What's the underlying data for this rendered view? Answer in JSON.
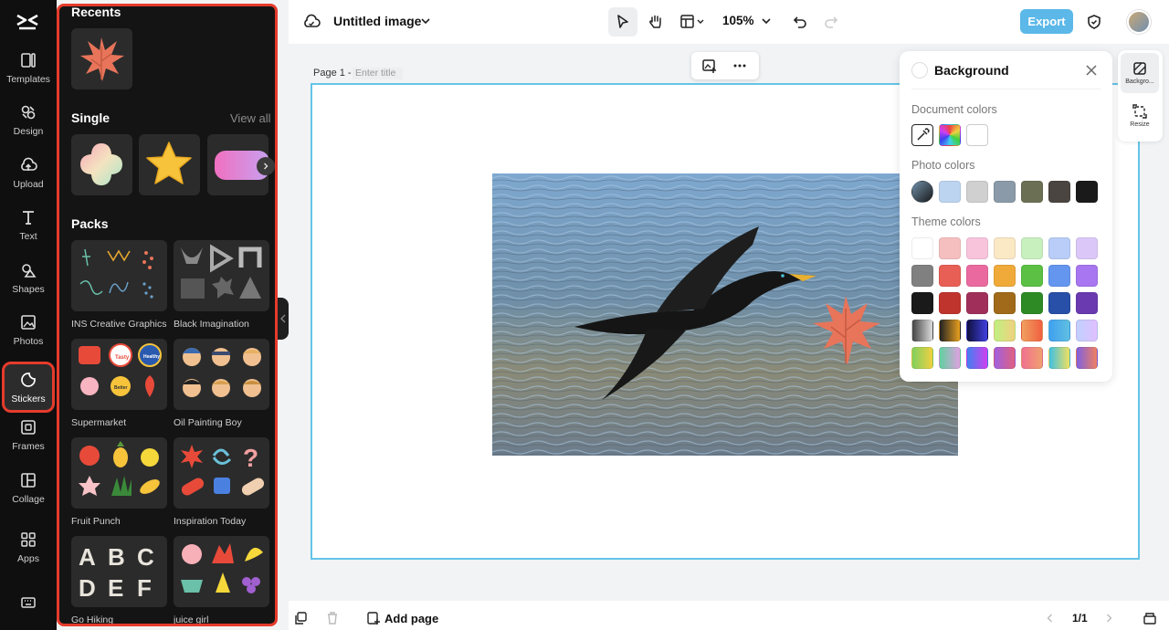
{
  "rail": {
    "items": [
      {
        "label": "Templates"
      },
      {
        "label": "Design"
      },
      {
        "label": "Upload"
      },
      {
        "label": "Text"
      },
      {
        "label": "Shapes"
      },
      {
        "label": "Photos"
      },
      {
        "label": "Stickers"
      },
      {
        "label": "Frames"
      },
      {
        "label": "Collage"
      },
      {
        "label": "Apps"
      }
    ],
    "active": "Stickers"
  },
  "panel": {
    "recents_title": "Recents",
    "single_title": "Single",
    "view_all": "View all",
    "packs_title": "Packs",
    "packs": [
      {
        "name": "INS Creative Graphics"
      },
      {
        "name": "Black Imagination"
      },
      {
        "name": "Supermarket"
      },
      {
        "name": "Oil Painting Boy"
      },
      {
        "name": "Fruit Punch"
      },
      {
        "name": "Inspiration Today"
      },
      {
        "name": "Go Hiking"
      },
      {
        "name": "juice girl"
      }
    ],
    "supermarket_badges": [
      "Tasty",
      "Healthy",
      "Better"
    ]
  },
  "topbar": {
    "title": "Untitled image",
    "zoom": "105%",
    "export_label": "Export"
  },
  "canvas": {
    "page_label": "Page 1 -",
    "page_title_placeholder": "Enter title"
  },
  "background_panel": {
    "title": "Background",
    "document_colors_label": "Document colors",
    "photo_colors_label": "Photo colors",
    "theme_colors_label": "Theme colors",
    "photo_colors": [
      "#bcd4f0",
      "#d0d0d0",
      "#8a9aa8",
      "#6b7055",
      "#4a4540",
      "#1a1a1a"
    ],
    "theme_colors": [
      [
        "#ffffff",
        "#f6bfbf",
        "#f8c4dc",
        "#fbe8c4",
        "#c8f0bf",
        "#b9cdf8",
        "#dcc8f8"
      ],
      [
        "#808080",
        "#e86055",
        "#ea6aa0",
        "#f0aa3a",
        "#5cc044",
        "#6496f0",
        "#a876f0"
      ],
      [
        "#1a1a1a",
        "#c0342e",
        "#a0305a",
        "#a06a1a",
        "#2e8a24",
        "#2850a8",
        "#6a3ab0"
      ]
    ]
  },
  "side_tabs": {
    "background_label": "Backgro...",
    "resize_label": "Resize"
  },
  "bottombar": {
    "add_page_label": "Add page",
    "pager": "1/1"
  }
}
